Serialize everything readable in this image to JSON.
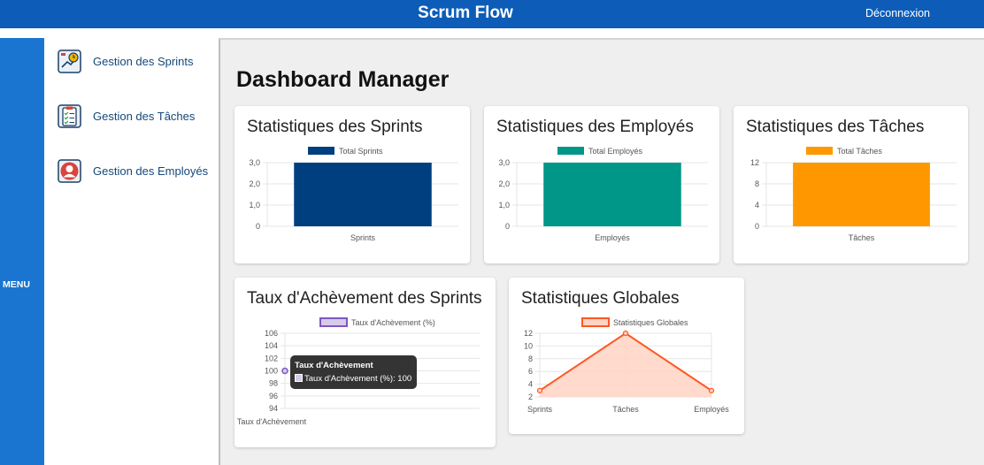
{
  "header": {
    "title": "Scrum Flow",
    "logout": "Déconnexion"
  },
  "menu": {
    "label": "MENU"
  },
  "sidebar": {
    "items": [
      {
        "label": "Gestion des Sprints",
        "icon": "sprint-clock-icon"
      },
      {
        "label": "Gestion des Tâches",
        "icon": "task-clipboard-icon"
      },
      {
        "label": "Gestion des Employés",
        "icon": "employee-avatar-icon"
      }
    ]
  },
  "page": {
    "title": "Dashboard Manager"
  },
  "cards": {
    "sprints": {
      "title": "Statistiques des Sprints"
    },
    "employees": {
      "title": "Statistiques des Employés"
    },
    "tasks": {
      "title": "Statistiques des Tâches"
    },
    "completion": {
      "title": "Taux d'Achèvement des Sprints"
    },
    "global": {
      "title": "Statistiques Globales"
    }
  },
  "tooltip": {
    "title": "Taux d'Achèvement",
    "body": "Taux d'Achèvement (%): 100"
  },
  "chart_data": [
    {
      "type": "bar",
      "categories": [
        "Sprints"
      ],
      "series": [
        {
          "name": "Total Sprints",
          "values": [
            3
          ]
        }
      ],
      "yticks": [
        "3,0",
        "2,0",
        "1,0",
        "0"
      ],
      "ylim": [
        0,
        3
      ],
      "color": "#003f7f"
    },
    {
      "type": "bar",
      "categories": [
        "Employés"
      ],
      "series": [
        {
          "name": "Total Employés",
          "values": [
            3
          ]
        }
      ],
      "yticks": [
        "3,0",
        "2,0",
        "1,0",
        "0"
      ],
      "ylim": [
        0,
        3
      ],
      "color": "#009688"
    },
    {
      "type": "bar",
      "categories": [
        "Tâches"
      ],
      "series": [
        {
          "name": "Total Tâches",
          "values": [
            12
          ]
        }
      ],
      "yticks": [
        "12",
        "8",
        "4",
        "0"
      ],
      "ylim": [
        0,
        12
      ],
      "color": "#ff9800"
    },
    {
      "type": "line",
      "categories": [
        "Taux d'Achèvement"
      ],
      "series": [
        {
          "name": "Taux d'Achèvement (%)",
          "values": [
            100
          ]
        }
      ],
      "yticks": [
        "106",
        "104",
        "102",
        "100",
        "98",
        "96",
        "94"
      ],
      "ylim": [
        94,
        106
      ],
      "color": "#7e57c2",
      "fill": "#d6cbe9"
    },
    {
      "type": "area",
      "categories": [
        "Sprints",
        "Tâches",
        "Employés"
      ],
      "series": [
        {
          "name": "Statistiques Globales",
          "values": [
            3,
            12,
            3
          ]
        }
      ],
      "yticks": [
        "12",
        "10",
        "8",
        "6",
        "4",
        "2"
      ],
      "ylim": [
        2,
        12
      ],
      "color": "#ff5722",
      "fill": "#ffd3c4"
    }
  ]
}
